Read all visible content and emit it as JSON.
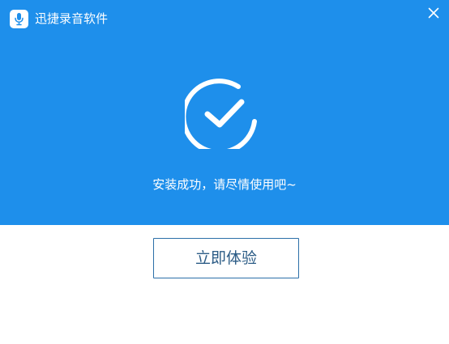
{
  "window": {
    "title": "迅捷录音软件",
    "app_icon": "microphone-icon",
    "close_icon": "close-icon"
  },
  "content": {
    "status_icon": "check-circle-icon",
    "message": "安装成功，请尽情使用吧~",
    "primary_button_label": "立即体验"
  },
  "colors": {
    "header_background": "#1E8FEB",
    "body_background": "#FFFFFF",
    "button_border": "#2B6FA8",
    "button_text": "#2C5C86",
    "text_on_header": "#FFFFFF"
  }
}
